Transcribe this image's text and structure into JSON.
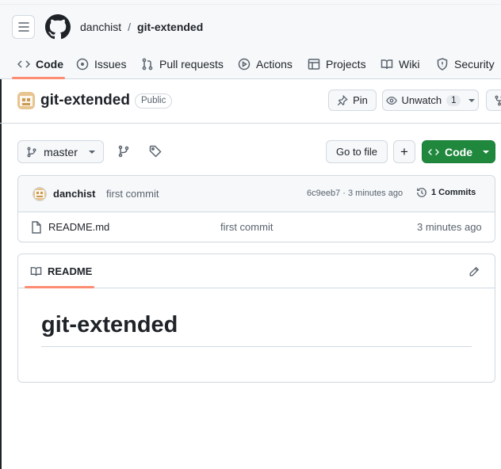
{
  "header": {
    "owner": "danchist",
    "separator": "/",
    "repo": "git-extended"
  },
  "tabs": [
    {
      "label": "Code",
      "icon": "code-icon",
      "active": true
    },
    {
      "label": "Issues",
      "icon": "issue-icon"
    },
    {
      "label": "Pull requests",
      "icon": "pull-request-icon"
    },
    {
      "label": "Actions",
      "icon": "play-icon"
    },
    {
      "label": "Projects",
      "icon": "table-icon"
    },
    {
      "label": "Wiki",
      "icon": "book-icon"
    },
    {
      "label": "Security",
      "icon": "shield-icon"
    }
  ],
  "repo_header": {
    "name": "git-extended",
    "visibility": "Public",
    "pin_label": "Pin",
    "unwatch_label": "Unwatch",
    "watch_count": "1"
  },
  "toolbar": {
    "branch": "master",
    "go_to_file": "Go to file",
    "add": "+",
    "code": "Code"
  },
  "latest_commit": {
    "author": "danchist",
    "message": "first commit",
    "meta": "6c9eeb7 · 3 minutes ago",
    "commits_label": "1 Commits"
  },
  "files": [
    {
      "name": "README.md",
      "message": "first commit",
      "age": "3 minutes ago"
    }
  ],
  "readme": {
    "tab_label": "README",
    "heading": "git-extended"
  },
  "colors": {
    "accent_underline": "#fd8c73",
    "primary_button": "#1f883d",
    "border": "#d1d9e0"
  }
}
